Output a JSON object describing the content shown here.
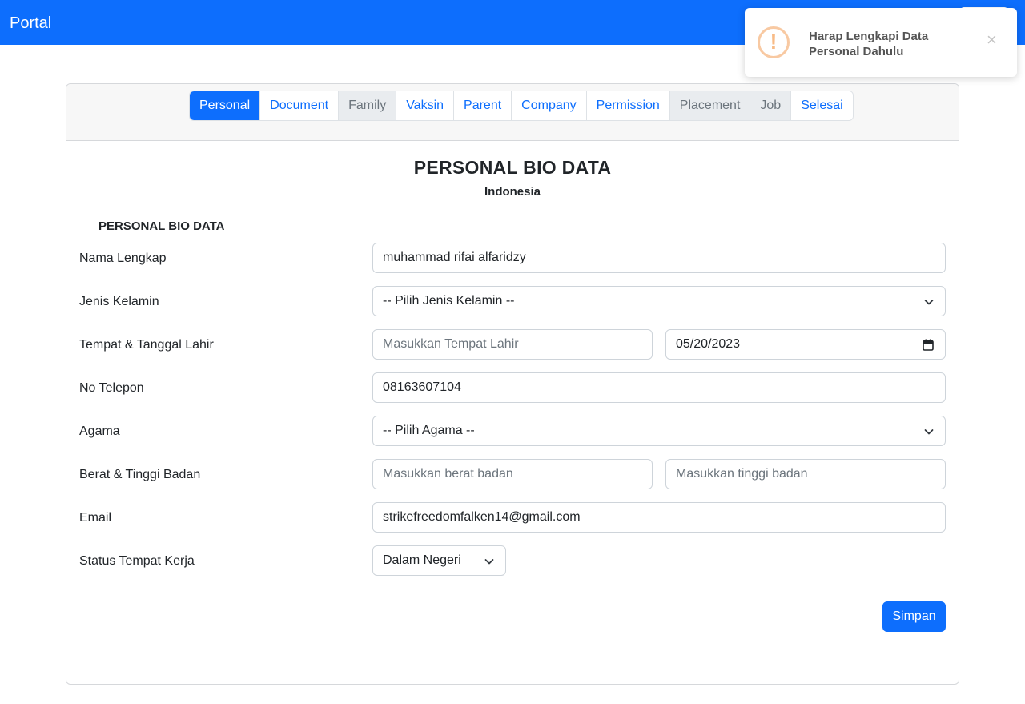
{
  "navbar": {
    "brand": "Portal"
  },
  "tabs": [
    {
      "label": "Personal",
      "state": "active"
    },
    {
      "label": "Document",
      "state": "enabled"
    },
    {
      "label": "Family",
      "state": "disabled"
    },
    {
      "label": "Vaksin",
      "state": "enabled"
    },
    {
      "label": "Parent",
      "state": "enabled"
    },
    {
      "label": "Company",
      "state": "enabled"
    },
    {
      "label": "Permission",
      "state": "enabled"
    },
    {
      "label": "Placement",
      "state": "disabled"
    },
    {
      "label": "Job",
      "state": "disabled"
    },
    {
      "label": "Selesai",
      "state": "enabled"
    }
  ],
  "page": {
    "title": "PERSONAL BIO DATA",
    "subtitle": "Indonesia",
    "section_title": "PERSONAL BIO DATA"
  },
  "form": {
    "nama_label": "Nama Lengkap",
    "nama_value": "muhammad rifai alfaridzy",
    "gender_label": "Jenis Kelamin",
    "gender_value": "-- Pilih Jenis Kelamin --",
    "ttl_label": "Tempat & Tanggal Lahir",
    "tempat_placeholder": "Masukkan Tempat Lahir",
    "tanggal_value": "05/20/2023",
    "telepon_label": "No Telepon",
    "telepon_value": "08163607104",
    "agama_label": "Agama",
    "agama_value": "-- Pilih Agama --",
    "berat_tinggi_label": "Berat & Tinggi Badan",
    "berat_placeholder": "Masukkan berat badan",
    "tinggi_placeholder": "Masukkan tinggi badan",
    "email_label": "Email",
    "email_value": "strikefreedomfalken14@gmail.com",
    "status_label": "Status Tempat Kerja",
    "status_value": "Dalam Negeri",
    "save_label": "Simpan"
  },
  "toast": {
    "icon": "exclamation-icon",
    "message": "Harap Lengkapi Data Personal Dahulu",
    "close_glyph": "×"
  },
  "colors": {
    "primary": "#0d6efd",
    "warning_icon": "#f8bb86",
    "disabled_tab_bg": "#e9ecef"
  }
}
